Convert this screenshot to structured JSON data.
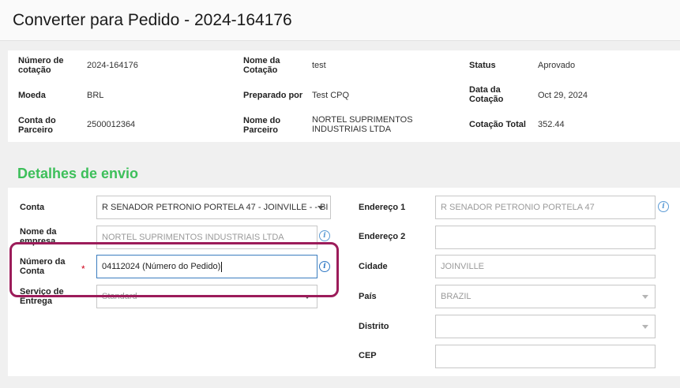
{
  "header": {
    "title": "Converter para Pedido - 2024-164176"
  },
  "summary": {
    "quote_number_label": "Número de cotação",
    "quote_number": "2024-164176",
    "quote_name_label": "Nome da Cotação",
    "quote_name": "test",
    "status_label": "Status",
    "status": "Aprovado",
    "currency_label": "Moeda",
    "currency": "BRL",
    "prepared_by_label": "Preparado por",
    "prepared_by": "Test CPQ",
    "quote_date_label": "Data da Cotação",
    "quote_date": "Oct 29, 2024",
    "partner_account_label": "Conta do Parceiro",
    "partner_account": "2500012364",
    "partner_name_label": "Nome do Parceiro",
    "partner_name": "NORTEL SUPRIMENTOS INDUSTRIAIS LTDA",
    "quote_total_label": "Cotação Total",
    "quote_total": "352.44"
  },
  "shipping": {
    "section_title": "Detalhes de envio",
    "account_label": "Conta",
    "account_value": "R SENADOR PETRONIO PORTELA 47 - JOINVILLE - - BI",
    "company_label": "Nome da empresa",
    "company_value": "NORTEL SUPRIMENTOS INDUSTRIAIS LTDA",
    "account_number_label": "Número da Conta",
    "account_number_value": "04112024 (Número do Pedido)",
    "required_mark": "*",
    "delivery_label": "Serviço de Entrega",
    "delivery_value": "Standard",
    "address1_label": "Endereço 1",
    "address1_value": "R SENADOR PETRONIO PORTELA 47",
    "address2_label": "Endereço 2",
    "address2_value": "",
    "city_label": "Cidade",
    "city_value": "JOINVILLE",
    "country_label": "País",
    "country_value": "BRAZIL",
    "district_label": "Distrito",
    "district_value": "",
    "zip_label": "CEP",
    "zip_value": ""
  },
  "icons": {
    "info": "info-icon",
    "dropdown": "chevron-down-icon"
  },
  "colors": {
    "section_title": "#3dbf5a",
    "highlight": "#9c1c5a",
    "focus_border": "#3b7dbf",
    "info": "#5b9bd5"
  }
}
